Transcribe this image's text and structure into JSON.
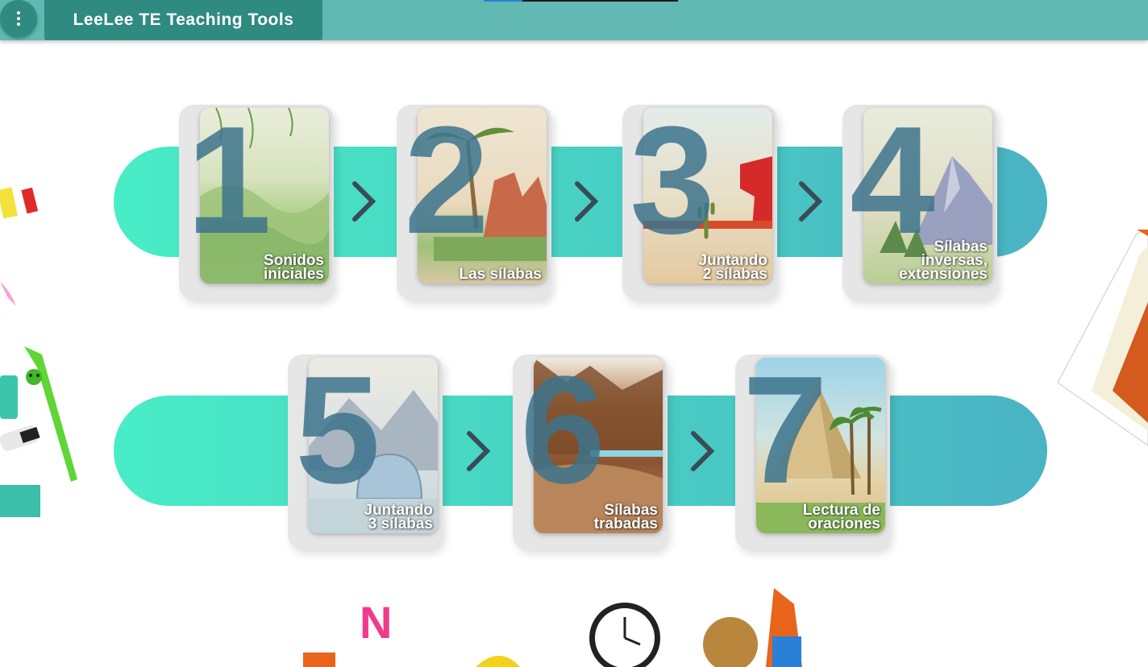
{
  "app": {
    "title": "LeeLee TE Teaching Tools",
    "menu_icon": "more-vert-icon"
  },
  "colors": {
    "bar": "#62b9b3",
    "accent": "#2f8a80",
    "band_start": "#48edc6",
    "band_end": "#4ab3c4",
    "number": "#3c738c"
  },
  "levels": [
    {
      "number": "1",
      "label": "Sonidos\niniciales"
    },
    {
      "number": "2",
      "label": "Las sílabas"
    },
    {
      "number": "3",
      "label": "Juntando\n2 sílabas"
    },
    {
      "number": "4",
      "label": "Sílabas\ninversas,\nextensiones"
    },
    {
      "number": "5",
      "label": "Juntando\n3 sílabas"
    },
    {
      "number": "6",
      "label": "Sílabas\ntrabadas"
    },
    {
      "number": "7",
      "label": "Lectura de\noraciones"
    }
  ]
}
